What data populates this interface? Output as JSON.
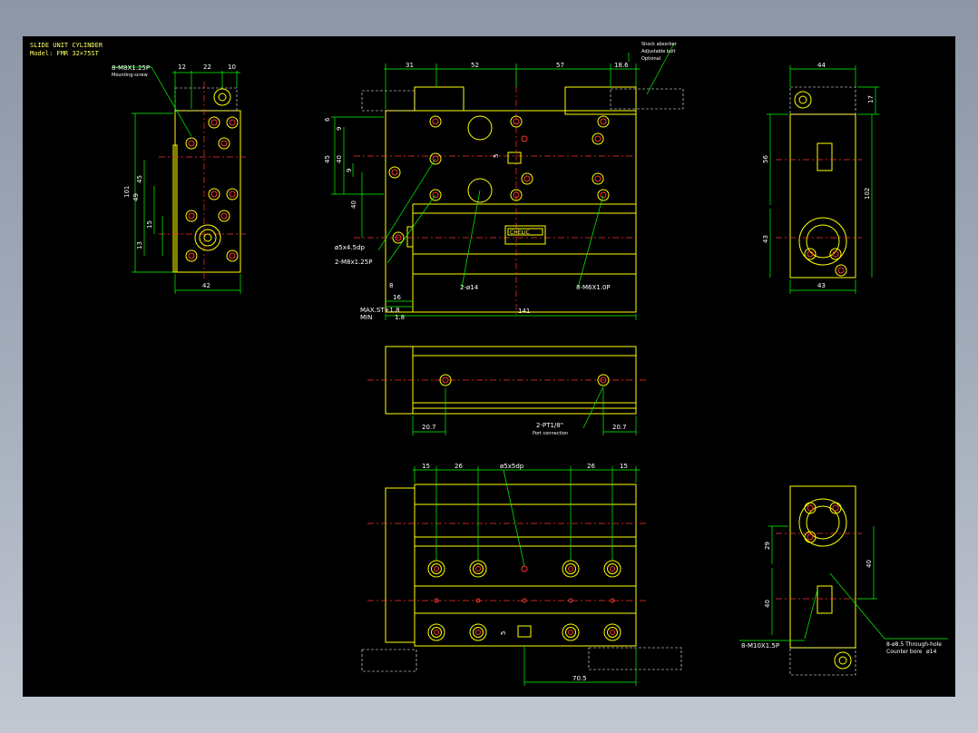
{
  "drawing": {
    "title": "SLIDE UNIT CYLINDER",
    "model": "Model: FMR 32×75ST",
    "colors": {
      "outline": "#ffff00",
      "dimension": "#00ff00",
      "center": "#ff3333",
      "hidden": "#ffffff",
      "text": "#ffff66"
    }
  },
  "left_view": {
    "dims_top": [
      "12",
      "22",
      "10"
    ],
    "dims_left": [
      "101",
      "45",
      "49",
      "15",
      "13"
    ],
    "dim_bottom": "42",
    "callout": "8-M8X1.25P",
    "callout_sub": "Mounting-screw"
  },
  "front_view": {
    "dims_top": [
      "31",
      "52",
      "57",
      "18.6"
    ],
    "dims_left": [
      "6",
      "9",
      "45",
      "40",
      "9",
      "40"
    ],
    "dims_bottom": [
      "8",
      "16",
      "141"
    ],
    "max_stroke": "MAX.ST+1.8",
    "min": "MIN",
    "min_value": "1.8",
    "callouts": [
      "ø5x4.5dp",
      "2-M8x1.25P",
      "2-ø14",
      "8-M6X1.0P"
    ],
    "small_dim": "5",
    "label_brand": "CHELIC",
    "legend": [
      "Shock absorber",
      "Adjustable bolt",
      "Optional"
    ]
  },
  "right_view": {
    "dim_top": "44",
    "dim_top_right": "17",
    "dims_left": [
      "56",
      "43"
    ],
    "dim_right": "102",
    "dim_bottom": "43"
  },
  "middle_view": {
    "dims_bottom": [
      "20.7",
      "20.7"
    ],
    "callout": "2-PT1/8\"",
    "callout_sub": "Port connection"
  },
  "bottom_view": {
    "dims_top": [
      "15",
      "26",
      "26",
      "15"
    ],
    "callout": "ø5x5dp",
    "small_dim": "5",
    "dim_bottom": "70.5"
  },
  "end_view": {
    "dims_left": [
      "29",
      "40"
    ],
    "dim_right": "40",
    "callouts": [
      "8-M10X1.5P",
      "8-ø8.5 Through-hole",
      "Counter bore"
    ],
    "counter_bore": "ø14"
  }
}
